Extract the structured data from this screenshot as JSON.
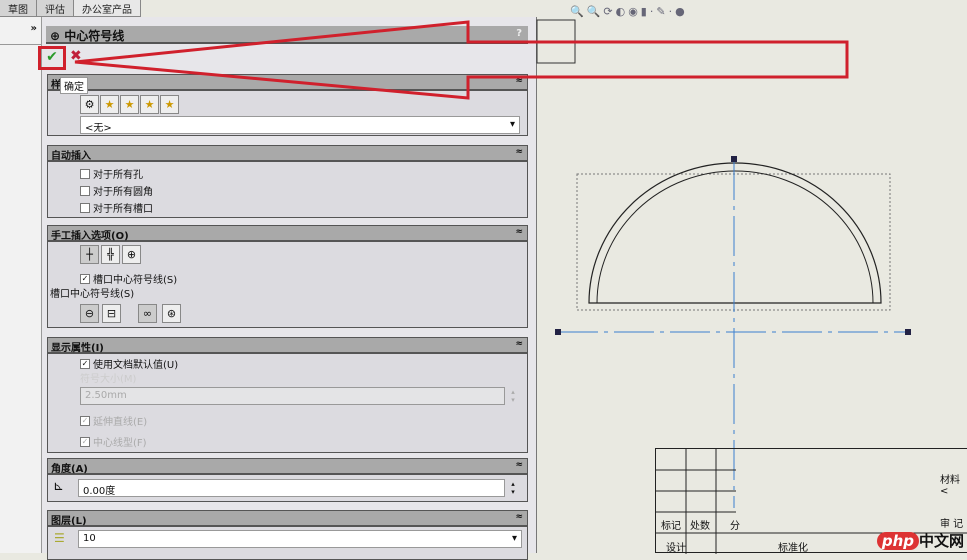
{
  "tabs": [
    "草图",
    "评估",
    "办公室产品"
  ],
  "left_strip": {
    "expand": "»"
  },
  "panel": {
    "title": "中心符号线",
    "help": "?",
    "tooltip": "确定",
    "style_section": {
      "title": "样",
      "select": "<无>"
    },
    "auto_insert": {
      "title": "自动插入",
      "options": [
        {
          "label": "对于所有孔",
          "checked": false
        },
        {
          "label": "对于所有圆角",
          "checked": false
        },
        {
          "label": "对于所有槽口",
          "checked": false
        }
      ]
    },
    "manual": {
      "title": "手工插入选项(O)",
      "slot_check": "槽口中心符号线(S)",
      "slot_label": "槽口中心符号线(S)"
    },
    "display": {
      "title": "显示属性(I)",
      "use_default": "使用文档默认值(U)",
      "mark_size": "符号大小(M)",
      "size_value": "2.50mm",
      "extend": "延伸直线(E)",
      "centerline": "中心线型(F)"
    },
    "angle": {
      "title": "角度(A)",
      "value": "0.00度"
    },
    "layer": {
      "title": "图层(L)",
      "value": "10"
    }
  },
  "title_block": {
    "cells": [
      "标记",
      "处数",
      "分",
      "设计",
      "标准化",
      "材料 <",
      "审 记"
    ]
  },
  "watermark": {
    "brand": "php",
    "text": "中文网"
  },
  "colors": {
    "arrow": "#d0202c",
    "centerline": "#3a7fd0"
  }
}
